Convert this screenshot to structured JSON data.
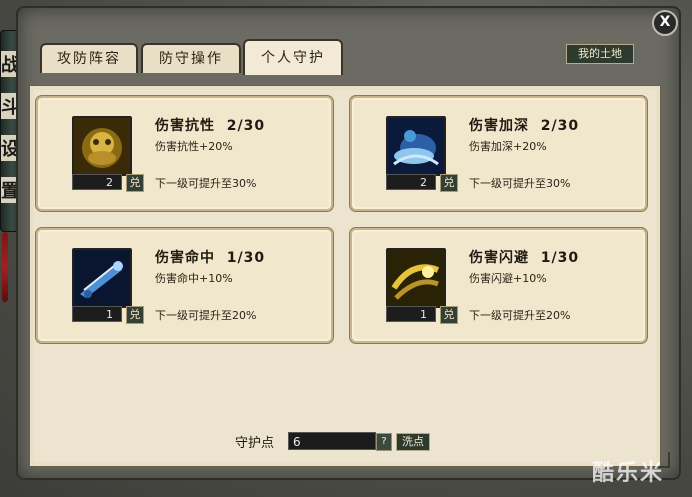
{
  "tabs": [
    {
      "label": "攻防阵容",
      "active": false
    },
    {
      "label": "防守操作",
      "active": false
    },
    {
      "label": "个人守护",
      "active": true
    }
  ],
  "my_land_button": "我的土地",
  "close_button": "X",
  "left_scroll_chars": [
    "战",
    "斗",
    "设",
    "置"
  ],
  "skills": [
    {
      "name": "伤害抗性",
      "level": "2/30",
      "effect": "伤害抗性+20%",
      "next": "下一级可提升至30%",
      "input_value": "2",
      "exchange_label": "兑",
      "icon": "golden-beast-icon"
    },
    {
      "name": "伤害加深",
      "level": "2/30",
      "effect": "伤害加深+20%",
      "next": "下一级可提升至30%",
      "input_value": "2",
      "exchange_label": "兑",
      "icon": "blue-spirit-icon"
    },
    {
      "name": "伤害命中",
      "level": "1/30",
      "effect": "伤害命中+10%",
      "next": "下一级可提升至20%",
      "input_value": "1",
      "exchange_label": "兑",
      "icon": "blue-arrow-icon"
    },
    {
      "name": "伤害闪避",
      "level": "1/30",
      "effect": "伤害闪避+10%",
      "next": "下一级可提升至20%",
      "input_value": "1",
      "exchange_label": "兑",
      "icon": "golden-wind-icon"
    }
  ],
  "guard_points": {
    "label": "守护点",
    "value": "6",
    "help_label": "?",
    "wash_label": "洗点"
  },
  "watermark": "酷乐米",
  "colors": {
    "panel": "#ece4ce",
    "card": "#f1e7cc",
    "button_bg": "#2e3a2e"
  }
}
